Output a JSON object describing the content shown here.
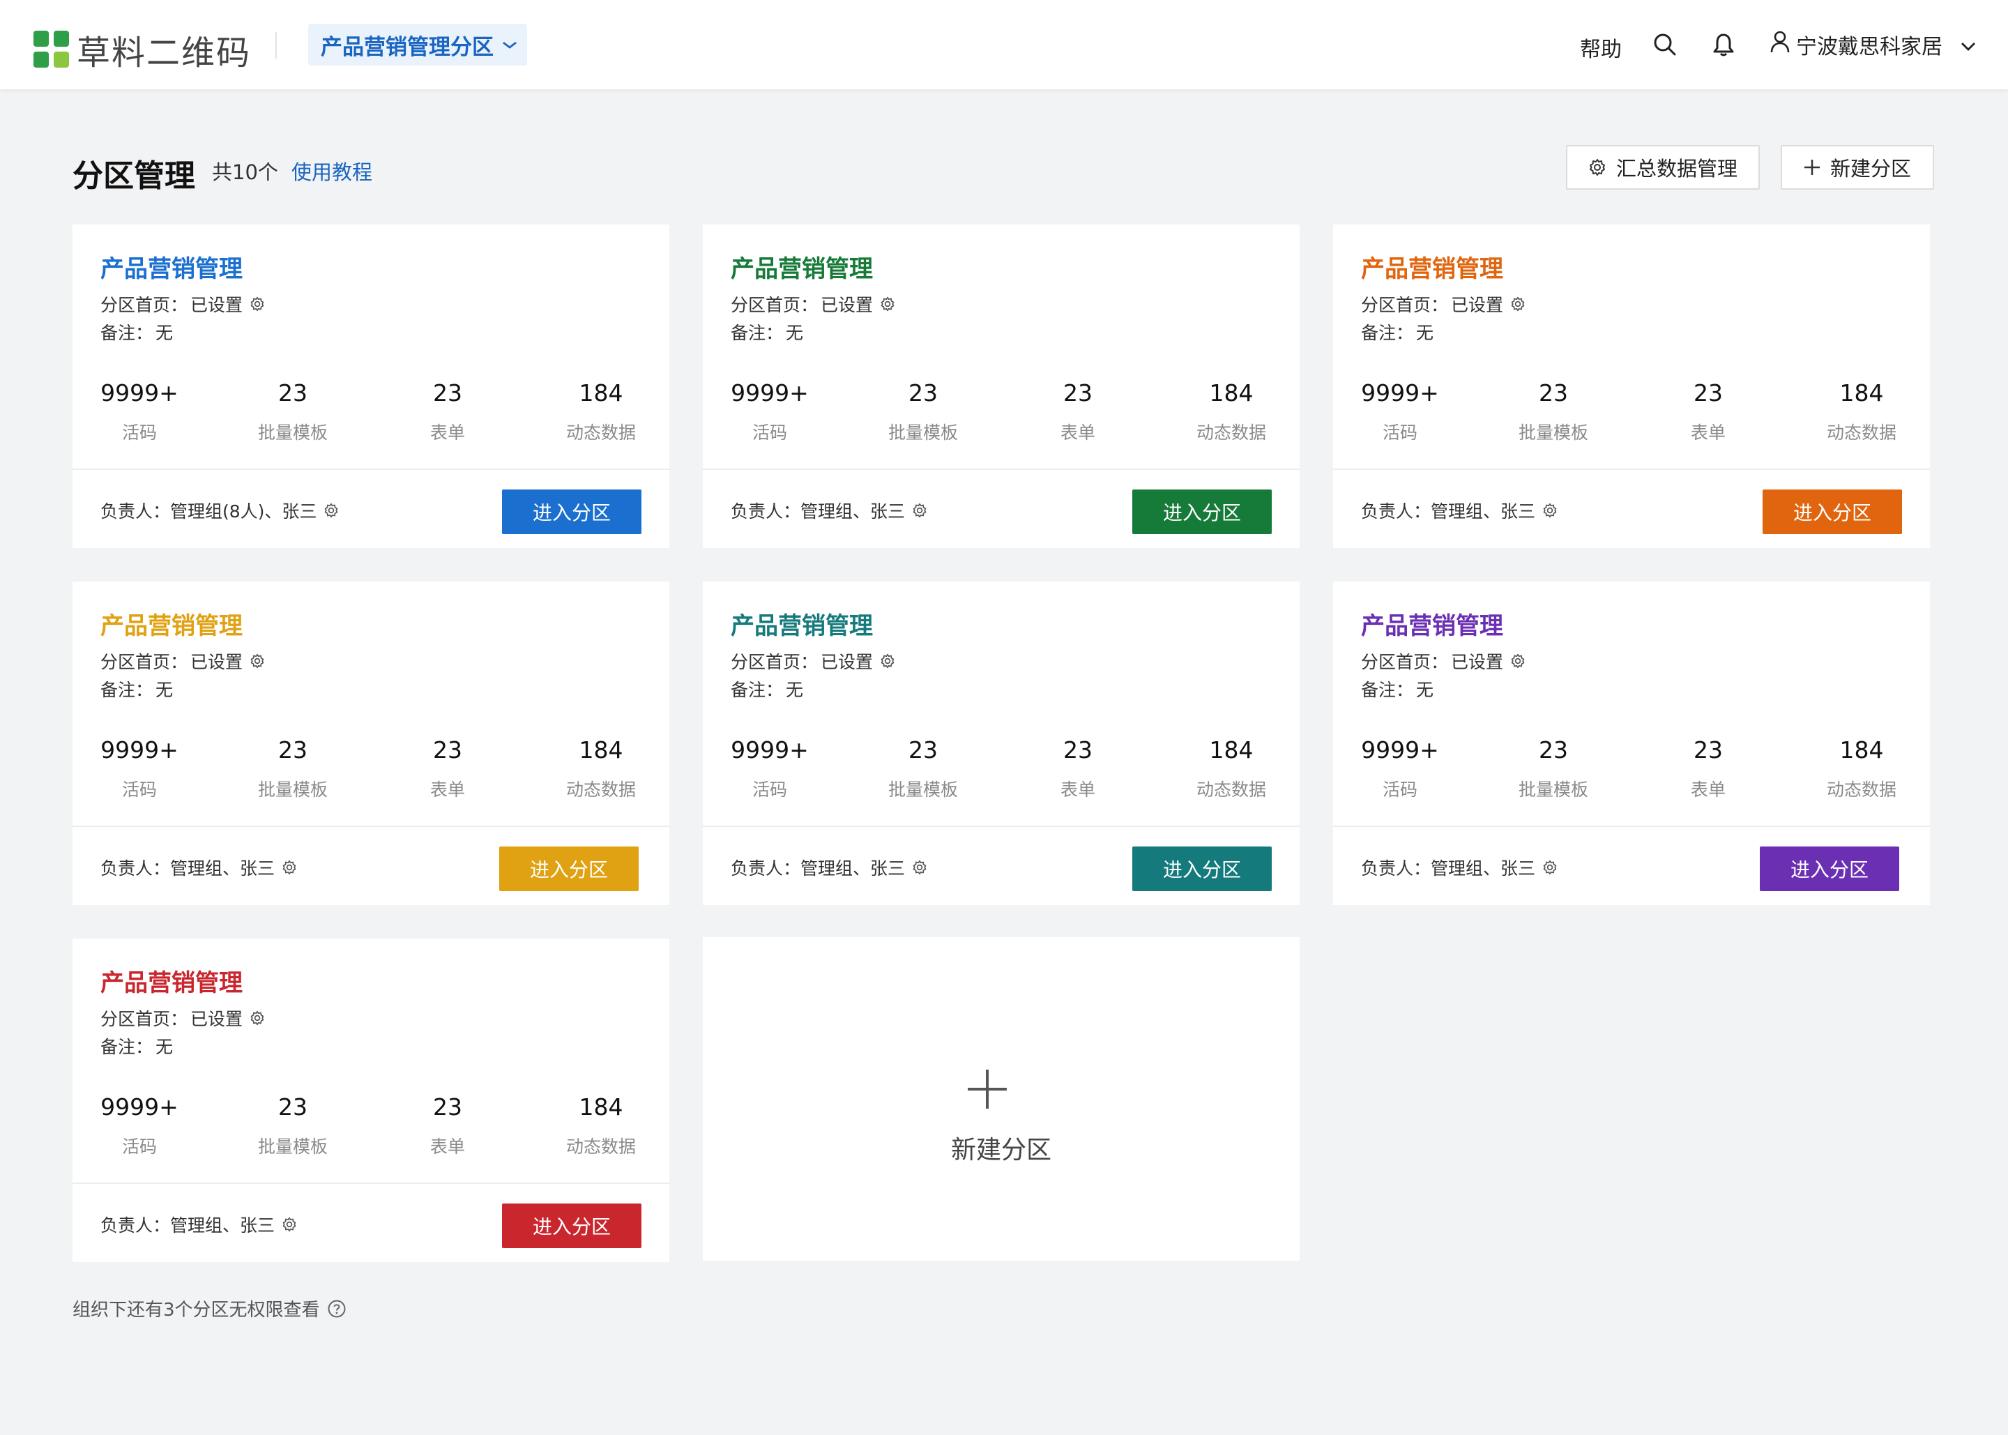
{
  "header": {
    "logo_text": "草料二维码",
    "logo_colors": [
      "#2e9f48",
      "#2e9f48",
      "#2e9f48",
      "#8cc63f"
    ],
    "dept_select_label": "产品营销管理分区",
    "help": "帮助",
    "user_name": "宁波戴思科家居"
  },
  "page": {
    "title": "分区管理",
    "count": "共10个",
    "tutorial": "使用教程",
    "summary_button": "汇总数据管理",
    "new_button": "新建分区"
  },
  "cards": [
    {
      "title": "产品营销管理",
      "color": "#1a6fcf",
      "home_label": "分区首页：",
      "home_value": "已设置",
      "note_label": "备注：",
      "note_value": "无",
      "stats": [
        {
          "num": "9999+",
          "label": "活码"
        },
        {
          "num": "23",
          "label": "批量模板"
        },
        {
          "num": "23",
          "label": "表单"
        },
        {
          "num": "184",
          "label": "动态数据"
        }
      ],
      "owner": "负责人：管理组(8人)、张三",
      "button": "进入分区"
    },
    {
      "title": "产品营销管理",
      "color": "#167a38",
      "home_label": "分区首页：",
      "home_value": "已设置",
      "note_label": "备注：",
      "note_value": "无",
      "stats": [
        {
          "num": "9999+",
          "label": "活码"
        },
        {
          "num": "23",
          "label": "批量模板"
        },
        {
          "num": "23",
          "label": "表单"
        },
        {
          "num": "184",
          "label": "动态数据"
        }
      ],
      "owner": "负责人：管理组、张三",
      "button": "进入分区"
    },
    {
      "title": "产品营销管理",
      "color": "#e0650e",
      "home_label": "分区首页：",
      "home_value": "已设置",
      "note_label": "备注：",
      "note_value": "无",
      "stats": [
        {
          "num": "9999+",
          "label": "活码"
        },
        {
          "num": "23",
          "label": "批量模板"
        },
        {
          "num": "23",
          "label": "表单"
        },
        {
          "num": "184",
          "label": "动态数据"
        }
      ],
      "owner": "负责人：管理组、张三",
      "button": "进入分区"
    },
    {
      "title": "产品营销管理",
      "color": "#e0a112",
      "home_label": "分区首页：",
      "home_value": "已设置",
      "note_label": "备注：",
      "note_value": "无",
      "stats": [
        {
          "num": "9999+",
          "label": "活码"
        },
        {
          "num": "23",
          "label": "批量模板"
        },
        {
          "num": "23",
          "label": "表单"
        },
        {
          "num": "184",
          "label": "动态数据"
        }
      ],
      "owner": "负责人：管理组、张三",
      "button": "进入分区"
    },
    {
      "title": "产品营销管理",
      "color": "#157a7c",
      "home_label": "分区首页：",
      "home_value": "已设置",
      "note_label": "备注：",
      "note_value": "无",
      "stats": [
        {
          "num": "9999+",
          "label": "活码"
        },
        {
          "num": "23",
          "label": "批量模板"
        },
        {
          "num": "23",
          "label": "表单"
        },
        {
          "num": "184",
          "label": "动态数据"
        }
      ],
      "owner": "负责人：管理组、张三",
      "button": "进入分区"
    },
    {
      "title": "产品营销管理",
      "color": "#6a2fb3",
      "home_label": "分区首页：",
      "home_value": "已设置",
      "note_label": "备注：",
      "note_value": "无",
      "stats": [
        {
          "num": "9999+",
          "label": "活码"
        },
        {
          "num": "23",
          "label": "批量模板"
        },
        {
          "num": "23",
          "label": "表单"
        },
        {
          "num": "184",
          "label": "动态数据"
        }
      ],
      "owner": "负责人：管理组、张三",
      "button": "进入分区"
    },
    {
      "title": "产品营销管理",
      "color": "#c9262e",
      "home_label": "分区首页：",
      "home_value": "已设置",
      "note_label": "备注：",
      "note_value": "无",
      "stats": [
        {
          "num": "9999+",
          "label": "活码"
        },
        {
          "num": "23",
          "label": "批量模板"
        },
        {
          "num": "23",
          "label": "表单"
        },
        {
          "num": "184",
          "label": "动态数据"
        }
      ],
      "owner": "负责人：管理组、张三",
      "button": "进入分区"
    }
  ],
  "new_card": {
    "label": "新建分区"
  },
  "footer_note": "组织下还有3个分区无权限查看"
}
